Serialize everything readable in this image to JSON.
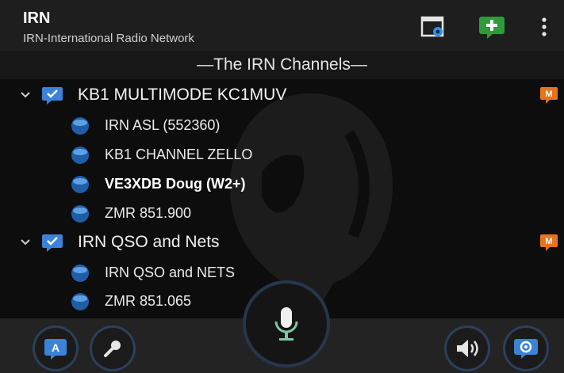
{
  "header": {
    "title": "IRN",
    "subtitle": "IRN-International Radio Network",
    "icons": {
      "settings": "window-gear-icon",
      "add": "add-chat-icon",
      "menu": "more-vert-icon"
    }
  },
  "sub_header": {
    "title": "—The IRN Channels—"
  },
  "groups": [
    {
      "label": "KB1 MULTIMODE KC1MUV",
      "badge": "M",
      "channels": [
        {
          "label": "IRN ASL (552360)",
          "bold": false
        },
        {
          "label": "KB1 CHANNEL ZELLO",
          "bold": false
        },
        {
          "label": "VE3XDB Doug (W2+)",
          "bold": true
        },
        {
          "label": "ZMR 851.900",
          "bold": false
        }
      ]
    },
    {
      "label": "IRN QSO and Nets",
      "badge": "M",
      "channels": [
        {
          "label": "IRN QSO and NETS",
          "bold": false
        },
        {
          "label": "ZMR 851.065",
          "bold": false
        }
      ]
    }
  ],
  "bottom_bar": {
    "left_button_letter": "A",
    "icons": [
      "a-bubble-icon",
      "microphone-small-icon",
      "microphone-icon",
      "speaker-icon",
      "chat-bubble-icon"
    ]
  },
  "colors": {
    "accent_blue": "#2a74c9",
    "badge_orange": "#e8731f",
    "add_green": "#2e9a3b",
    "mic_green": "#7fc7a0"
  }
}
